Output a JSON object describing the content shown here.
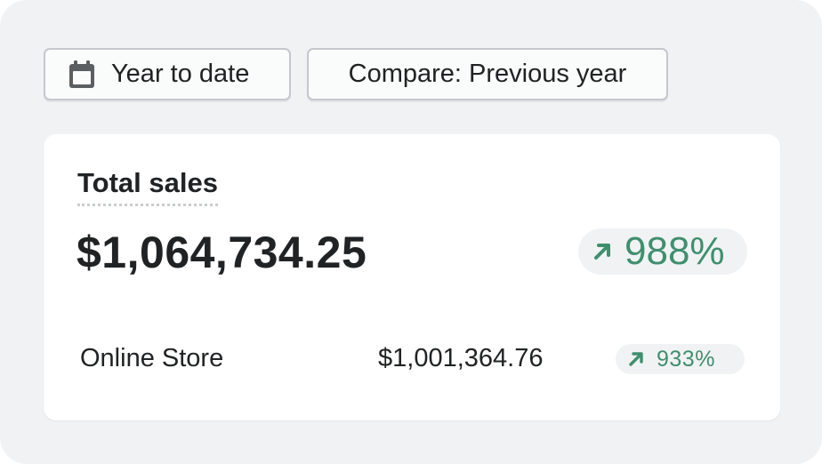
{
  "filters": {
    "date_range_label": "Year to date",
    "compare_label": "Compare: Previous year"
  },
  "card": {
    "title": "Total sales",
    "total_value": "$1,064,734.25",
    "total_change": "988%",
    "breakdown": [
      {
        "label": "Online Store",
        "value": "$1,001,364.76",
        "change": "933%"
      }
    ]
  },
  "icons": {
    "date_button": "calendar-icon",
    "change_indicator": "arrow-up-right-icon"
  },
  "colors": {
    "positive": "#3f8f6e",
    "background": "#f1f2f4",
    "card": "#ffffff",
    "text": "#202223"
  }
}
